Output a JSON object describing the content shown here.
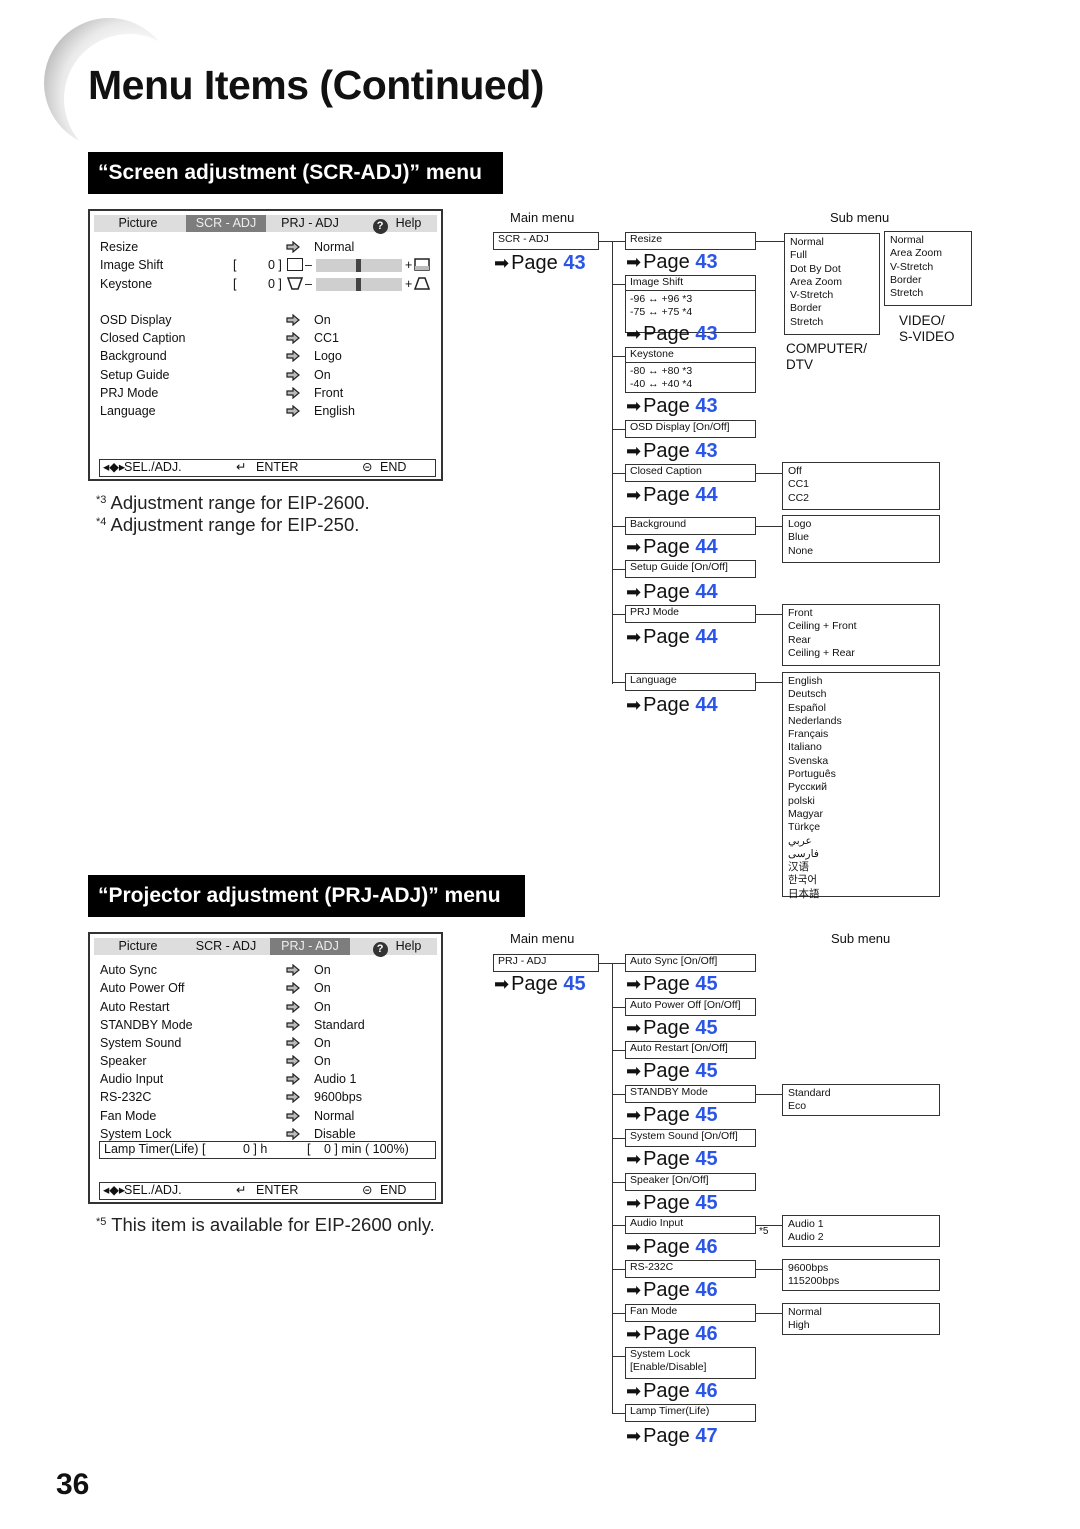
{
  "page": {
    "title": "Menu Items (Continued)",
    "number": "36"
  },
  "scr": {
    "banner": "“Screen adjustment (SCR-ADJ)” menu",
    "osd": {
      "tabs": [
        "Picture",
        "SCR - ADJ",
        "PRJ - ADJ",
        "Help"
      ],
      "active_tab": "SCR - ADJ",
      "rows": [
        {
          "label": "Resize",
          "value": "Normal"
        },
        {
          "label": "Image Shift",
          "value": "0",
          "slider_fraction": 0.5
        },
        {
          "label": "Keystone",
          "value": "0",
          "slider_fraction": 0.5
        },
        {
          "label": "OSD Display",
          "value": "On"
        },
        {
          "label": "Closed Caption",
          "value": "CC1"
        },
        {
          "label": "Background",
          "value": "Logo"
        },
        {
          "label": "Setup Guide",
          "value": "On"
        },
        {
          "label": "PRJ Mode",
          "value": "Front"
        },
        {
          "label": "Language",
          "value": "English"
        }
      ],
      "bracket_open": "[",
      "bracket_close": "0 ]",
      "minus": "–",
      "plus": "+",
      "footer": {
        "sel": "SEL./ADJ.",
        "enter": "ENTER",
        "end": "END"
      }
    },
    "notes": [
      {
        "mark": "*3",
        "text": "Adjustment range for EIP-2600."
      },
      {
        "mark": "*4",
        "text": "Adjustment range for EIP-250."
      }
    ],
    "tree": {
      "main_label": "Main menu",
      "sub_label": "Sub menu",
      "main": {
        "label": "SCR - ADJ",
        "page": "43"
      },
      "page_word": "Page",
      "items": [
        {
          "label": "Resize",
          "page": "43"
        },
        {
          "label": "Image Shift",
          "ranges": [
            "-96 ↔ +96  *3",
            "-75 ↔ +75  *4"
          ],
          "page": "43"
        },
        {
          "label": "Keystone",
          "ranges": [
            "-80 ↔ +80  *3",
            "-40 ↔ +40  *4"
          ],
          "page": "43"
        },
        {
          "label": "OSD Display [On/Off]",
          "page": "43"
        },
        {
          "label": "Closed Caption",
          "page": "44"
        },
        {
          "label": "Background",
          "page": "44"
        },
        {
          "label": "Setup Guide [On/Off]",
          "page": "44"
        },
        {
          "label": "PRJ Mode",
          "page": "44"
        },
        {
          "label": "Language",
          "page": "44"
        }
      ],
      "submenus": {
        "resize_computer": {
          "options": [
            "Normal",
            "Full",
            "Dot By Dot",
            "Area Zoom",
            "V-Stretch",
            "Border",
            "Stretch"
          ],
          "caption": [
            "COMPUTER/",
            "DTV"
          ]
        },
        "resize_video": {
          "options": [
            "Normal",
            "Area Zoom",
            "V-Stretch",
            "Border",
            "Stretch"
          ],
          "caption": [
            "VIDEO/",
            "S-VIDEO"
          ]
        },
        "closed_caption": [
          "Off",
          "CC1",
          "CC2"
        ],
        "background": [
          "Logo",
          "Blue",
          "None"
        ],
        "prj_mode": [
          "Front",
          "Ceiling + Front",
          "Rear",
          "Ceiling + Rear"
        ],
        "language": [
          "English",
          "Deutsch",
          "Español",
          "Nederlands",
          "Français",
          "Italiano",
          "Svenska",
          "Português",
          "Русский",
          "polski",
          "Magyar",
          "Türkçe",
          "عربي",
          "فارسی",
          "汉语",
          "한국어",
          "日本語"
        ]
      }
    }
  },
  "prj": {
    "banner": "“Projector adjustment (PRJ-ADJ)” menu",
    "osd": {
      "tabs": [
        "Picture",
        "SCR - ADJ",
        "PRJ - ADJ",
        "Help"
      ],
      "active_tab": "PRJ - ADJ",
      "rows": [
        {
          "label": "Auto Sync",
          "value": "On"
        },
        {
          "label": "Auto Power Off",
          "value": "On"
        },
        {
          "label": "Auto Restart",
          "value": "On"
        },
        {
          "label": "STANDBY Mode",
          "value": "Standard"
        },
        {
          "label": "System Sound",
          "value": "On"
        },
        {
          "label": "Speaker",
          "value": "On"
        },
        {
          "label": "Audio Input",
          "value": "Audio 1"
        },
        {
          "label": "RS-232C",
          "value": "9600bps"
        },
        {
          "label": "Fan Mode",
          "value": "Normal"
        },
        {
          "label": "System Lock",
          "value": "Disable"
        }
      ],
      "lamp": {
        "label": "Lamp Timer(Life)  [",
        "hours": "0 ] h",
        "min_open": "[",
        "minutes": "0 ] min ( 100%)"
      },
      "footer": {
        "sel": "SEL./ADJ.",
        "enter": "ENTER",
        "end": "END"
      }
    },
    "notes": [
      {
        "mark": "*5",
        "text": "This item is available for EIP-2600 only."
      }
    ],
    "tree": {
      "main_label": "Main menu",
      "sub_label": "Sub menu",
      "main": {
        "label": "PRJ - ADJ",
        "page": "45"
      },
      "page_word": "Page",
      "items": [
        {
          "label": "Auto Sync [On/Off]",
          "page": "45"
        },
        {
          "label": "Auto Power Off [On/Off]",
          "page": "45"
        },
        {
          "label": "Auto Restart [On/Off]",
          "page": "45"
        },
        {
          "label": "STANDBY Mode",
          "page": "45"
        },
        {
          "label": "System Sound [On/Off]",
          "page": "45"
        },
        {
          "label": "Speaker [On/Off]",
          "page": "45"
        },
        {
          "label": "Audio Input",
          "page": "46",
          "note": "*5"
        },
        {
          "label": "RS-232C",
          "page": "46"
        },
        {
          "label": "Fan Mode",
          "page": "46"
        },
        {
          "label": "System Lock",
          "label2": "[Enable/Disable]",
          "page": "46"
        },
        {
          "label": "Lamp Timer(Life)",
          "page": "47"
        }
      ],
      "submenus": {
        "standby": [
          "Standard",
          "Eco"
        ],
        "audio_input": [
          "Audio 1",
          "Audio 2"
        ],
        "rs232c": [
          "9600bps",
          "115200bps"
        ],
        "fan_mode": [
          "Normal",
          "High"
        ]
      }
    }
  },
  "colors": {
    "page_link": "#2a55e6",
    "banner_bg": "#000000",
    "active_tab": "#7d7d7d"
  }
}
